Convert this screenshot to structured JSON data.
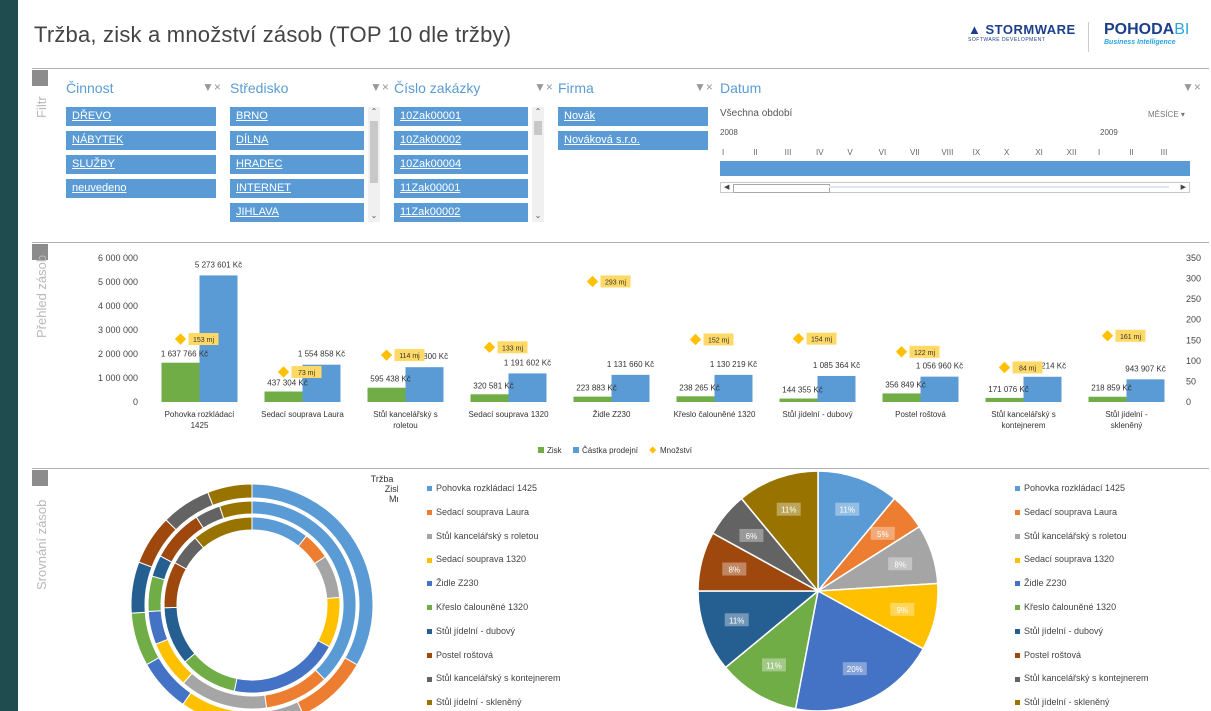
{
  "header": {
    "title": "Tržba, zisk a množství zásob (TOP 10 dle tržby)",
    "logo1_big": "STORMWARE",
    "logo1_small": "SOFTWARE DEVELOPMENT",
    "logo2_big": "POHODA",
    "logo2_bi": "BI",
    "logo2_small": "Business Intelligence"
  },
  "sections": {
    "filter": "Filtr",
    "overview": "Přehled zásob",
    "compare": "Srovnání zásob"
  },
  "slicers": [
    {
      "title": "Činnost",
      "items": [
        "DŘEVO",
        "NÁBYTEK",
        "SLUŽBY",
        "neuvedeno"
      ]
    },
    {
      "title": "Středisko",
      "items": [
        "BRNO",
        "DÍLNA",
        "HRADEC",
        "INTERNET",
        "JIHLAVA"
      ]
    },
    {
      "title": "Číslo zakázky",
      "items": [
        "10Zak00001",
        "10Zak00002",
        "10Zak00004",
        "11Zak00001",
        "11Zak00002"
      ]
    },
    {
      "title": "Firma",
      "items": [
        "Novák",
        "Nováková s.r.o."
      ]
    }
  ],
  "timeline": {
    "title": "Datum",
    "subtitle": "Všechna období",
    "level": "MĚSÍCE",
    "year1": "2008",
    "year2": "2009",
    "months": [
      "I",
      "II",
      "III",
      "IV",
      "V",
      "VI",
      "VII",
      "VIII",
      "IX",
      "X",
      "XI",
      "XII",
      "I",
      "II",
      "III"
    ]
  },
  "colors": {
    "zisk": "#70ad47",
    "castka": "#5b9bd5",
    "mnozstvi": "#ffc000",
    "slices": [
      "#5b9bd5",
      "#ed7d31",
      "#a5a5a5",
      "#ffc000",
      "#4472c4",
      "#70ad47",
      "#255e91",
      "#9e480e",
      "#636363",
      "#997300"
    ]
  },
  "chart_data": [
    {
      "type": "bar",
      "categories": [
        "Pohovka rozkládací 1425",
        "Sedací souprava Laura",
        "Stůl kancelářský s roletou",
        "Sedací souprava 1320",
        "Židle Z230",
        "Křeslo čalouněné 1320",
        "Stůl jídelní - dubový",
        "Postel roštová",
        "Stůl kancelářský s kontejnerem",
        "Stůl jídelní - skleněný"
      ],
      "series": [
        {
          "name": "Zisk",
          "values": [
            1637766,
            437304,
            595438,
            320581,
            223883,
            238265,
            144355,
            356849,
            171076,
            218859
          ],
          "labels": [
            "1 637 766 Kč",
            "437 304 Kč",
            "595 438 Kč",
            "320 581 Kč",
            "223 883 Kč",
            "238 265 Kč",
            "144 355 Kč",
            "356 849 Kč",
            "171 076 Kč",
            "218 859 Kč"
          ]
        },
        {
          "name": "Částka prodejní",
          "values": [
            5273601,
            1554858,
            1450800,
            1191602,
            1131660,
            1130219,
            1085364,
            1056960,
            1052214,
            943907
          ],
          "labels": [
            "5 273 601 Kč",
            "1 554 858 Kč",
            "1 450 800 Kč",
            "1 191 602 Kč",
            "1 131 660 Kč",
            "1 130 219 Kč",
            "1 085 364 Kč",
            "1 056 960 Kč",
            "1 052 214 Kč",
            "943 907 Kč"
          ]
        },
        {
          "name": "Množství",
          "values": [
            153,
            73,
            114,
            133,
            293,
            152,
            154,
            122,
            84,
            161
          ],
          "labels": [
            "153 mj",
            "73 mj",
            "114 mj",
            "133 mj",
            "293 mj",
            "152 mj",
            "154 mj",
            "122 mj",
            "84 mj",
            "161 mj"
          ]
        }
      ],
      "yticks": [
        "6 000 000",
        "5 000 000",
        "4 000 000",
        "3 000 000",
        "2 000 000",
        "1 000 000",
        "0"
      ],
      "y2ticks": [
        "350",
        "300",
        "250",
        "200",
        "150",
        "100",
        "50",
        "0"
      ],
      "ylim": [
        0,
        6000000
      ],
      "y2lim": [
        0,
        350
      ],
      "legend": "bottom"
    },
    {
      "type": "pie",
      "subtype": "doughnut",
      "ring_labels": [
        "Tržba",
        "Zisk",
        "Množství"
      ],
      "categories": [
        "Pohovka rozkládací 1425",
        "Sedací souprava Laura",
        "Stůl kancelářský s roletou",
        "Sedací souprava 1320",
        "Židle Z230",
        "Křeslo čalouněné 1320",
        "Stůl jídelní - dubový",
        "Postel roštová",
        "Stůl kancelářský s kontejnerem",
        "Stůl jídelní - skleněný"
      ],
      "legend": "right"
    },
    {
      "type": "pie",
      "categories": [
        "Pohovka rozkládací 1425",
        "Sedací souprava Laura",
        "Stůl kancelářský s roletou",
        "Sedací souprava 1320",
        "Židle Z230",
        "Křeslo čalouněné 1320",
        "Stůl jídelní - dubový",
        "Postel roštová",
        "Stůl kancelářský s kontejnerem",
        "Stůl jídelní - skleněný"
      ],
      "values": [
        11,
        5,
        8,
        9,
        20,
        11,
        11,
        8,
        6,
        11
      ],
      "labels": [
        "11%",
        "5%",
        "8%",
        "9%",
        "20%",
        "11%",
        "11%",
        "8%",
        "6%",
        "11%"
      ],
      "legend": "right"
    }
  ]
}
